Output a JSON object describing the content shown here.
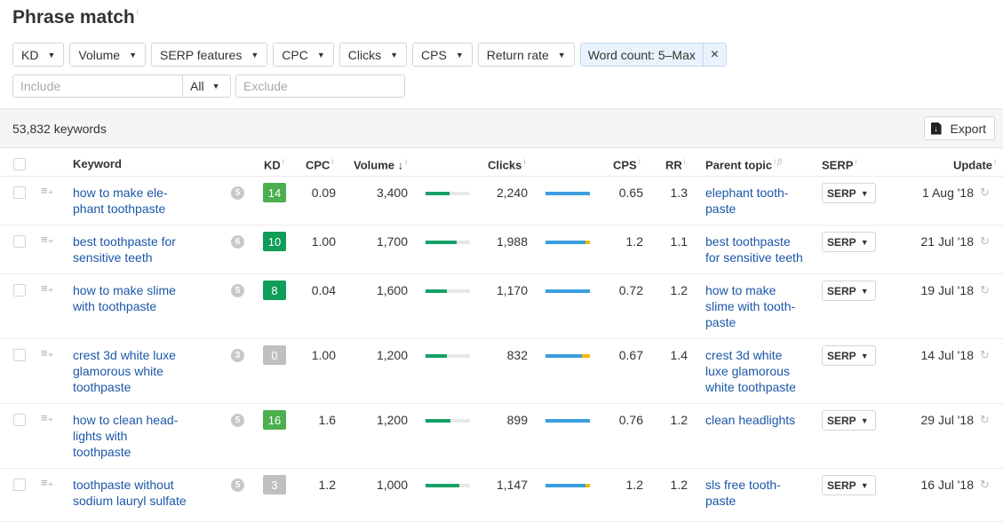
{
  "page": {
    "title": "Phrase match",
    "info": "i"
  },
  "filters": [
    {
      "label": "KD"
    },
    {
      "label": "Volume"
    },
    {
      "label": "SERP features"
    },
    {
      "label": "CPC"
    },
    {
      "label": "Clicks"
    },
    {
      "label": "CPS"
    },
    {
      "label": "Return rate"
    }
  ],
  "active_filter": {
    "label": "Word count: 5–Max",
    "close": "×"
  },
  "search": {
    "include_placeholder": "Include",
    "mode": "All",
    "exclude_placeholder": "Exclude"
  },
  "summary": {
    "count": "53,832 keywords",
    "export_label": "Export"
  },
  "columns": {
    "keyword": "Keyword",
    "kd": "KD",
    "cpc": "CPC",
    "volume": "Volume",
    "sort_arrow": "↓",
    "clicks": "Clicks",
    "cps": "CPS",
    "rr": "RR",
    "parent_topic": "Parent topic",
    "beta": "β",
    "serp": "SERP",
    "update": "Update",
    "info": "i"
  },
  "colors": {
    "kd_green": "#4caf50",
    "kd_dark_green": "#0f9d58",
    "kd_gray": "#c0c0c0",
    "link": "#1b57a8",
    "volume_bar": "#17a067",
    "clicks_organic": "#3a9de0",
    "clicks_paid": "#f7b500"
  },
  "rows": [
    {
      "keyword": [
        "how to make ele-",
        "phant toothpaste"
      ],
      "serp_features": "5",
      "kd": "14",
      "kd_color": "#4caf50",
      "cpc": "0.09",
      "volume": "3,400",
      "volume_fill": 0.54,
      "clicks": "2,240",
      "clicks_organic": 1.0,
      "clicks_paid": 0.0,
      "cps": "0.65",
      "rr": "1.3",
      "parent_topic": [
        "elephant tooth-",
        "paste"
      ],
      "serp": "SERP",
      "update": "1 Aug '18"
    },
    {
      "keyword": [
        "best toothpaste for",
        "sensitive teeth"
      ],
      "serp_features": "6",
      "kd": "10",
      "kd_color": "#0f9d58",
      "cpc": "1.00",
      "volume": "1,700",
      "volume_fill": 0.7,
      "clicks": "1,988",
      "clicks_organic": 0.9,
      "clicks_paid": 0.1,
      "cps": "1.2",
      "rr": "1.1",
      "parent_topic": [
        "best toothpaste",
        "for sensitive teeth"
      ],
      "serp": "SERP",
      "update": "21 Jul '18"
    },
    {
      "keyword": [
        "how to make slime",
        "with toothpaste"
      ],
      "serp_features": "5",
      "kd": "8",
      "kd_color": "#0f9d58",
      "cpc": "0.04",
      "volume": "1,600",
      "volume_fill": 0.47,
      "clicks": "1,170",
      "clicks_organic": 1.0,
      "clicks_paid": 0.0,
      "cps": "0.72",
      "rr": "1.2",
      "parent_topic": [
        "how to make",
        "slime with tooth-",
        "paste"
      ],
      "serp": "SERP",
      "update": "19 Jul '18"
    },
    {
      "keyword": [
        "crest 3d white luxe",
        "glamorous white",
        "toothpaste"
      ],
      "serp_features": "3",
      "kd": "0",
      "kd_color": "#c0c0c0",
      "cpc": "1.00",
      "volume": "1,200",
      "volume_fill": 0.47,
      "clicks": "832",
      "clicks_organic": 0.82,
      "clicks_paid": 0.18,
      "cps": "0.67",
      "rr": "1.4",
      "parent_topic": [
        "crest 3d white",
        "luxe glamorous",
        "white toothpaste"
      ],
      "serp": "SERP",
      "update": "14 Jul '18"
    },
    {
      "keyword": [
        "how to clean head-",
        "lights with",
        "toothpaste"
      ],
      "serp_features": "5",
      "kd": "16",
      "kd_color": "#4caf50",
      "cpc": "1.6",
      "volume": "1,200",
      "volume_fill": 0.56,
      "clicks": "899",
      "clicks_organic": 1.0,
      "clicks_paid": 0.0,
      "cps": "0.76",
      "rr": "1.2",
      "parent_topic": [
        "clean headlights"
      ],
      "serp": "SERP",
      "update": "29 Jul '18"
    },
    {
      "keyword": [
        "toothpaste without",
        "sodium lauryl sulfate"
      ],
      "serp_features": "5",
      "kd": "3",
      "kd_color": "#c0c0c0",
      "cpc": "1.2",
      "volume": "1,000",
      "volume_fill": 0.76,
      "clicks": "1,147",
      "clicks_organic": 0.9,
      "clicks_paid": 0.1,
      "cps": "1.2",
      "rr": "1.2",
      "parent_topic": [
        "sls free tooth-",
        "paste"
      ],
      "serp": "SERP",
      "update": "16 Jul '18"
    }
  ]
}
